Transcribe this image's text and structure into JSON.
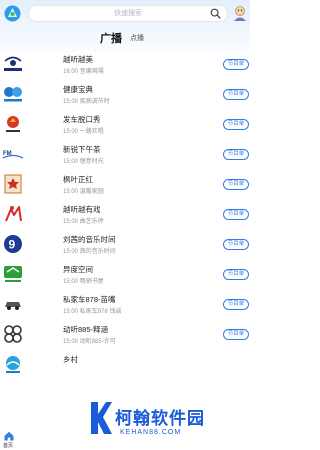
{
  "header": {
    "search_placeholder": "快速搜索"
  },
  "tabs": {
    "active": "广播",
    "inactive": "点播"
  },
  "button_label": "节目单",
  "stations": [
    {
      "name": "越听越美",
      "time": "16:00",
      "program": "音樂現場",
      "logo": "tianjin-music-logo"
    },
    {
      "name": "健康宝典",
      "time": "15:00",
      "program": "疾病调节时",
      "logo": "health-radio-logo"
    },
    {
      "name": "发车脱口秀",
      "time": "15:00",
      "program": "一路欢唱",
      "logo": "traffic-radio-logo"
    },
    {
      "name": "新锐下午茶",
      "time": "15:00",
      "program": "惬意时光",
      "logo": "fm-radio-logo"
    },
    {
      "name": "枫叶正红",
      "time": "15:00",
      "program": "温暖家园",
      "logo": "maple-logo"
    },
    {
      "name": "越听越有戏",
      "time": "15:00",
      "program": "曲艺乐停",
      "logo": "opera-logo"
    },
    {
      "name": "刘茜的音乐时间",
      "time": "15:00",
      "program": "茜的音乐时间",
      "logo": "music-9-logo"
    },
    {
      "name": "异度空间",
      "time": "15:00",
      "program": "畅销书屋",
      "logo": "tianjin-news-logo"
    },
    {
      "name": "私家车878-苗嘴",
      "time": "15:00",
      "program": "私家车878 钱诚",
      "logo": "car-878-logo"
    },
    {
      "name": "动听885-释涵",
      "time": "15:00",
      "program": "动听885-许可",
      "logo": "dongting-885-logo"
    },
    {
      "name": "乡村",
      "time": "",
      "program": "",
      "logo": "rural-radio-logo"
    }
  ],
  "bottom_nav": {
    "home_label": "首页"
  },
  "watermark": {
    "brand": "柯翰软件园",
    "url": "KEHAN88.COM"
  },
  "colors": {
    "accent": "#2f7be8",
    "watermark": "#1a5bd9"
  }
}
